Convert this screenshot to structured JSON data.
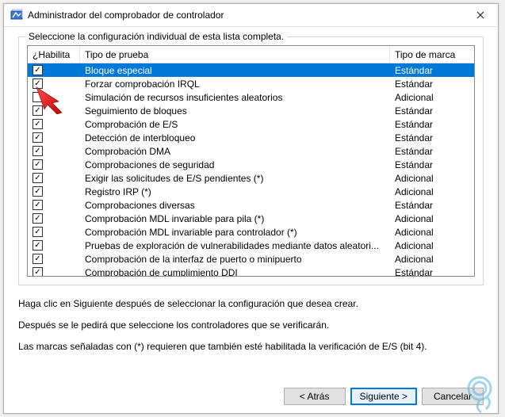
{
  "window": {
    "title": "Administrador del comprobador de controlador"
  },
  "group": {
    "label": "Seleccione la configuración individual de esta lista completa."
  },
  "columns": {
    "enable": "¿Habilita",
    "test_type": "Tipo de prueba",
    "mark_type": "Tipo de marca"
  },
  "rows": [
    {
      "checked": true,
      "selected": true,
      "name": "Bloque especial",
      "mark": "Estándar"
    },
    {
      "checked": true,
      "selected": false,
      "name": "Forzar comprobación IRQL",
      "mark": "Estándar"
    },
    {
      "checked": false,
      "selected": false,
      "name": "Simulación de recursos insuficientes aleatorios",
      "mark": "Adicional"
    },
    {
      "checked": true,
      "selected": false,
      "name": "Seguimiento de bloques",
      "mark": "Estándar"
    },
    {
      "checked": true,
      "selected": false,
      "name": "Comprobación de E/S",
      "mark": "Estándar"
    },
    {
      "checked": true,
      "selected": false,
      "name": "Detección de interbloqueo",
      "mark": "Estándar"
    },
    {
      "checked": true,
      "selected": false,
      "name": "Comprobación DMA",
      "mark": "Estándar"
    },
    {
      "checked": true,
      "selected": false,
      "name": "Comprobaciones de seguridad",
      "mark": "Estándar"
    },
    {
      "checked": true,
      "selected": false,
      "name": "Exigir las solicitudes de E/S pendientes (*)",
      "mark": "Adicional"
    },
    {
      "checked": true,
      "selected": false,
      "name": "Registro IRP (*)",
      "mark": "Adicional"
    },
    {
      "checked": true,
      "selected": false,
      "name": "Comprobaciones diversas",
      "mark": "Estándar"
    },
    {
      "checked": true,
      "selected": false,
      "name": "Comprobación MDL invariable para pila (*)",
      "mark": "Adicional"
    },
    {
      "checked": true,
      "selected": false,
      "name": "Comprobación MDL invariable para controlador (*)",
      "mark": "Adicional"
    },
    {
      "checked": true,
      "selected": false,
      "name": "Pruebas de exploración de vulnerabilidades mediante datos aleatori...",
      "mark": "Adicional"
    },
    {
      "checked": true,
      "selected": false,
      "name": "Comprobación de la interfaz de puerto o minipuerto",
      "mark": "Adicional"
    },
    {
      "checked": true,
      "selected": false,
      "name": "Comprobación de cumplimiento DDI",
      "mark": "Estándar"
    }
  ],
  "instructions": {
    "line1": "Haga clic en Siguiente después de seleccionar la configuración que desea crear.",
    "line2": "Después se le pedirá que seleccione los controladores que se verificarán.",
    "line3": "Las marcas señaladas con (*) requieren que también esté habilitada la verificación de E/S (bit 4)."
  },
  "buttons": {
    "back": "< Atrás",
    "next": "Siguiente >",
    "cancel": "Cancelar"
  }
}
